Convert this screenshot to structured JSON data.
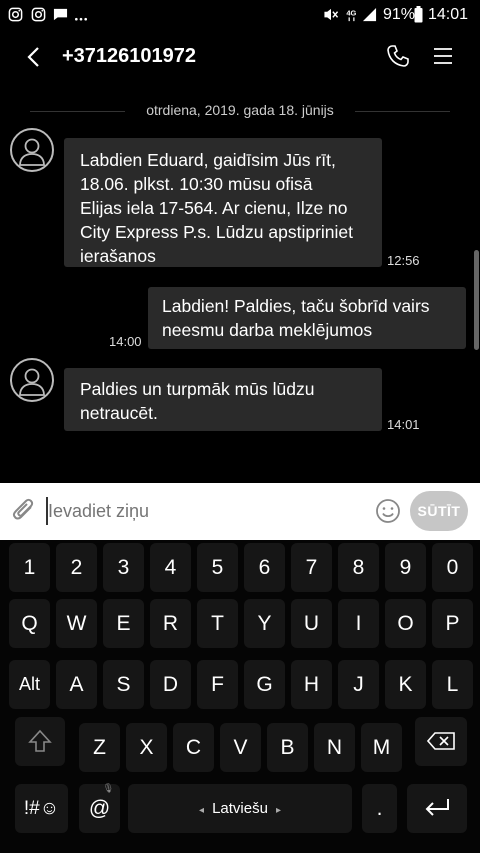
{
  "status_bar": {
    "battery": "91%",
    "time": "14:01",
    "network": "4G"
  },
  "header": {
    "title": "+37126101972"
  },
  "chat": {
    "date_separator": "otrdiena, 2019. gada 18. jūnijs",
    "messages": [
      {
        "direction": "incoming",
        "lines": [
          "Labdien Eduard, gaidīsim Jūs rīt,",
          "18.06. plkst. 10:30 mūsu ofisā",
          "Elijas iela 17-564. Ar cienu, Ilze no",
          "City Express P.s. Lūdzu apstipriniet",
          "ierašanos"
        ],
        "time": "12:56"
      },
      {
        "direction": "outgoing",
        "lines": [
          "Labdien! Paldies, taču šobrīd vairs",
          "neesmu darba meklējumos"
        ],
        "time": "14:00"
      },
      {
        "direction": "incoming",
        "lines": [
          "Paldies un turpmāk mūs lūdzu",
          "netraucēt."
        ],
        "time": "14:01"
      }
    ]
  },
  "composer": {
    "placeholder": "Ievadiet ziņu",
    "send_label": "SŪTĪT"
  },
  "keyboard": {
    "row1": [
      "1",
      "2",
      "3",
      "4",
      "5",
      "6",
      "7",
      "8",
      "9",
      "0"
    ],
    "row2": [
      "Q",
      "W",
      "E",
      "R",
      "T",
      "Y",
      "U",
      "I",
      "O",
      "P"
    ],
    "row3": [
      "Alt",
      "A",
      "S",
      "D",
      "F",
      "G",
      "H",
      "J",
      "K",
      "L"
    ],
    "row4": [
      "Z",
      "X",
      "C",
      "V",
      "B",
      "N",
      "M"
    ],
    "symbols_label": "!#☺",
    "at_label": "@",
    "language_label": "Latviešu",
    "period_label": ".",
    "mic_glyph": "🎙"
  }
}
